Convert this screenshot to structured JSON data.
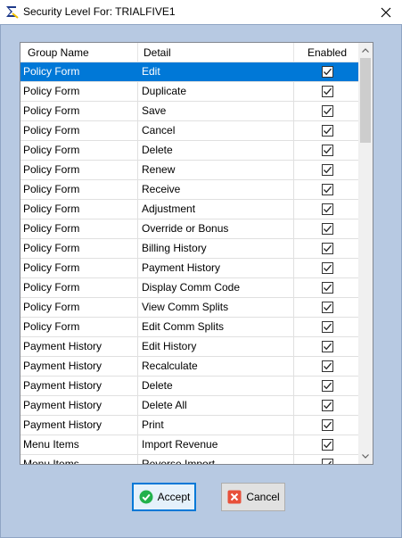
{
  "window": {
    "title": "Security Level For: TRIALFIVE1"
  },
  "grid": {
    "columns": [
      "Group Name",
      "Detail",
      "Enabled"
    ],
    "rows": [
      {
        "group": "Policy Form",
        "detail": "Edit",
        "enabled": true,
        "selected": true
      },
      {
        "group": "Policy Form",
        "detail": "Duplicate",
        "enabled": true
      },
      {
        "group": "Policy Form",
        "detail": "Save",
        "enabled": true
      },
      {
        "group": "Policy Form",
        "detail": "Cancel",
        "enabled": true
      },
      {
        "group": "Policy Form",
        "detail": "Delete",
        "enabled": true
      },
      {
        "group": "Policy Form",
        "detail": "Renew",
        "enabled": true
      },
      {
        "group": "Policy Form",
        "detail": "Receive",
        "enabled": true
      },
      {
        "group": "Policy Form",
        "detail": "Adjustment",
        "enabled": true
      },
      {
        "group": "Policy Form",
        "detail": "Override or Bonus",
        "enabled": true
      },
      {
        "group": "Policy Form",
        "detail": "Billing History",
        "enabled": true
      },
      {
        "group": "Policy Form",
        "detail": "Payment History",
        "enabled": true
      },
      {
        "group": "Policy Form",
        "detail": "Display Comm Code",
        "enabled": true
      },
      {
        "group": "Policy Form",
        "detail": "View Comm Splits",
        "enabled": true
      },
      {
        "group": "Policy Form",
        "detail": "Edit Comm Splits",
        "enabled": true
      },
      {
        "group": "Payment History",
        "detail": "Edit History",
        "enabled": true
      },
      {
        "group": "Payment History",
        "detail": "Recalculate",
        "enabled": true
      },
      {
        "group": "Payment History",
        "detail": "Delete",
        "enabled": true
      },
      {
        "group": "Payment History",
        "detail": "Delete All",
        "enabled": true
      },
      {
        "group": "Payment History",
        "detail": "Print",
        "enabled": true
      },
      {
        "group": "Menu Items",
        "detail": "Import Revenue",
        "enabled": true
      },
      {
        "group": "Menu Items",
        "detail": "Reverse Import",
        "enabled": true
      }
    ],
    "scroll_position": 0.0
  },
  "buttons": {
    "accept_label": "Accept",
    "cancel_label": "Cancel"
  },
  "colors": {
    "client_bg": "#b7c9e2",
    "selection": "#0078d7",
    "accept_icon": "#22b14c",
    "cancel_icon": "#e8503a"
  },
  "icons": {
    "app": "sigma-app-icon",
    "close": "close-icon",
    "accept": "check-circle-icon",
    "cancel": "x-square-icon"
  }
}
